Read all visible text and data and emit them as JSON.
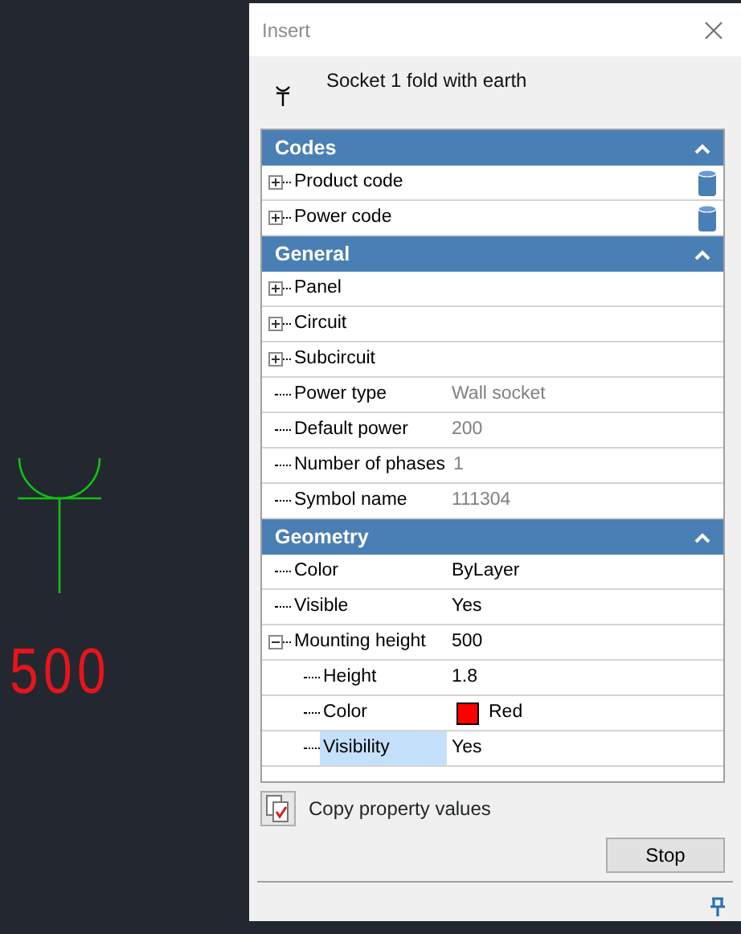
{
  "canvas": {
    "dimension": "500"
  },
  "window": {
    "title": "Insert"
  },
  "symbol": {
    "name": "Socket 1 fold with earth"
  },
  "sections": [
    {
      "title": "Codes",
      "expanded": true,
      "rows": [
        {
          "label": "Product code",
          "expanded": false,
          "kind": "lookup",
          "selected": false
        },
        {
          "label": "Power code",
          "expanded": false,
          "kind": "lookup",
          "selected": false
        }
      ]
    },
    {
      "title": "General",
      "expanded": true,
      "rows": [
        {
          "label": "Panel",
          "expanded": false,
          "kind": "text",
          "selected": false
        },
        {
          "label": "Circuit",
          "expanded": false,
          "kind": "text",
          "selected": false
        },
        {
          "label": "Subcircuit",
          "expanded": false,
          "kind": "text",
          "selected": false
        },
        {
          "label": "Power type",
          "value": "Wall socket",
          "kind": "text",
          "disabled": true,
          "selected": false
        },
        {
          "label": "Default power",
          "value": "200",
          "kind": "text",
          "disabled": true,
          "selected": false
        },
        {
          "label": "Number of phases",
          "value": "1",
          "kind": "text",
          "disabled": true,
          "selected": false
        },
        {
          "label": "Symbol name",
          "value": "111304",
          "kind": "text",
          "disabled": true,
          "selected": false
        }
      ]
    },
    {
      "title": "Geometry",
      "expanded": true,
      "rows": [
        {
          "label": "Color",
          "value": "ByLayer",
          "kind": "text",
          "selected": false
        },
        {
          "label": "Visible",
          "value": "Yes",
          "kind": "text",
          "selected": false
        },
        {
          "label": "Mounting height",
          "value": "500",
          "kind": "text",
          "expanded": true,
          "selected": false,
          "children": [
            {
              "label": "Height",
              "value": "1.8",
              "kind": "text",
              "selected": false
            },
            {
              "label": "Color",
              "value": "Red",
              "kind": "swatch",
              "color": "#ff0000",
              "selected": false
            },
            {
              "label": "Visibility",
              "value": "Yes",
              "kind": "text",
              "selected": true
            }
          ]
        }
      ]
    }
  ],
  "copy_button": {
    "label": "Copy property values"
  },
  "stop_button": {
    "label": "Stop"
  }
}
